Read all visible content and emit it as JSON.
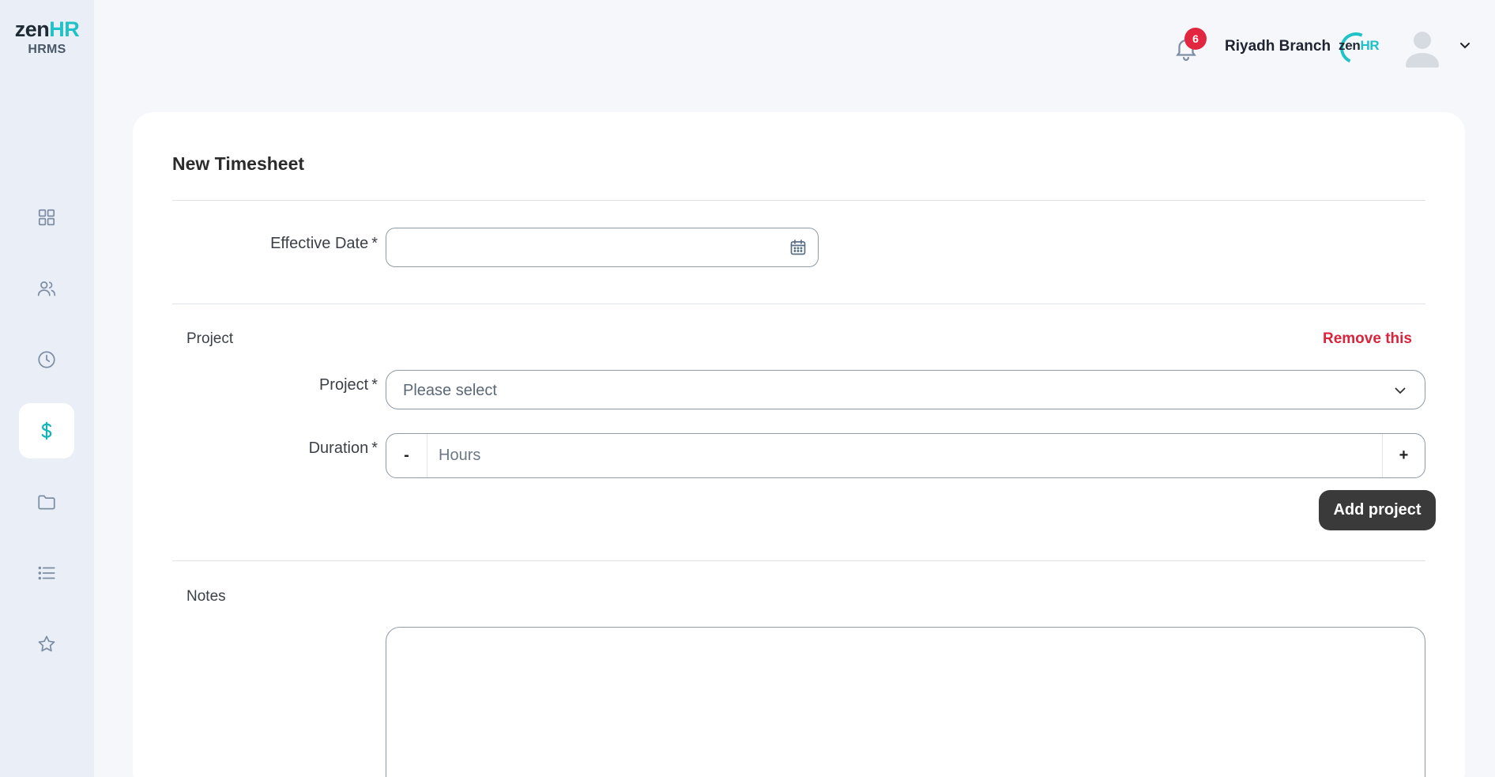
{
  "brand": {
    "name_prefix": "zen",
    "name_suffix": "HR",
    "subtitle": "HRMS"
  },
  "sidebar": {
    "items": [
      {
        "icon": "dashboard-grid-icon",
        "active": false
      },
      {
        "icon": "people-icon",
        "active": false
      },
      {
        "icon": "clock-icon",
        "active": false
      },
      {
        "icon": "dollar-icon",
        "active": true
      },
      {
        "icon": "folder-icon",
        "active": false
      },
      {
        "icon": "list-icon",
        "active": false
      },
      {
        "icon": "star-icon",
        "active": false
      }
    ]
  },
  "header": {
    "notification_count": "6",
    "branch": "Riyadh Branch",
    "company_logo": {
      "prefix": "zen",
      "suffix": "HR"
    }
  },
  "form": {
    "title": "New Timesheet",
    "effective_date": {
      "label": "Effective Date",
      "required": "*",
      "value": ""
    },
    "project_section": {
      "heading": "Project",
      "remove_label": "Remove this",
      "project_field": {
        "label": "Project",
        "required": "*",
        "selected": "Please select"
      },
      "duration_field": {
        "label": "Duration",
        "required": "*",
        "minus": "-",
        "plus": "+",
        "placeholder": "Hours"
      },
      "add_label": "Add project"
    },
    "notes": {
      "heading": "Notes",
      "value": ""
    }
  },
  "colors": {
    "accent": "#1fc2c6",
    "danger": "#d9243c",
    "badge": "#e3263f",
    "dark_button": "#3a3a3a",
    "sidebar_bg": "#e9eef7"
  }
}
